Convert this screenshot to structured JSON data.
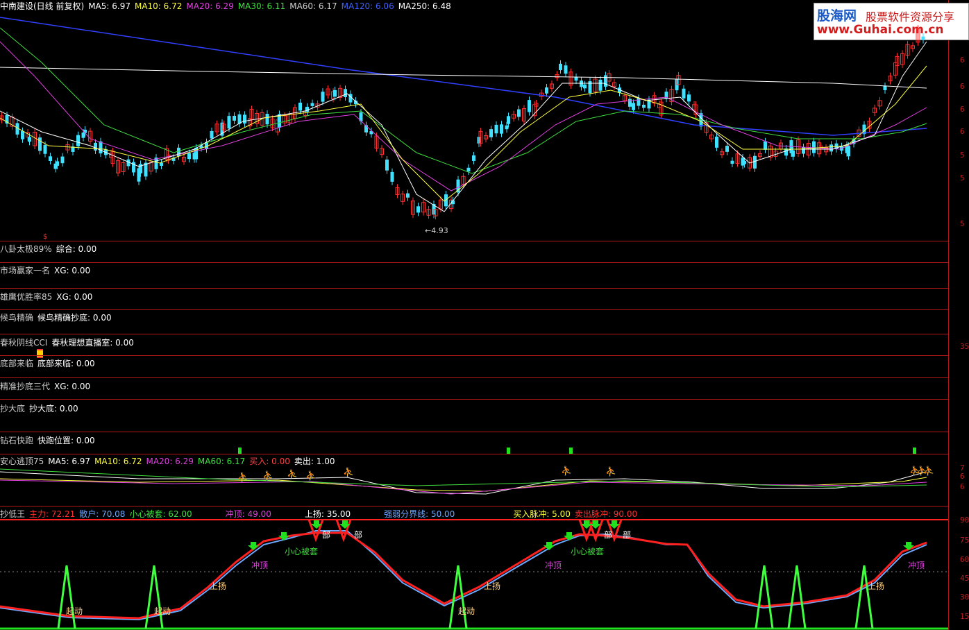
{
  "main": {
    "title": "中南建设(日线 前复权)",
    "ma_items": [
      {
        "label": "MA5: 6.97",
        "color": "#ffffff"
      },
      {
        "label": "MA10: 6.72",
        "color": "#ffff40"
      },
      {
        "label": "MA20: 6.29",
        "color": "#e040e0"
      },
      {
        "label": "MA30: 6.11",
        "color": "#40e040"
      },
      {
        "label": "MA60: 6.17",
        "color": "#d0d0d0"
      },
      {
        "label": "MA120: 6.06",
        "color": "#4060ff"
      },
      {
        "label": "MA250: 6.48",
        "color": "#ffffff"
      }
    ],
    "low_label": "4.93",
    "right_axis": [
      "6",
      "6",
      "6",
      "6",
      "5",
      "5",
      "5"
    ]
  },
  "logo": {
    "name": "股海网",
    "slogan": "股票软件资源分享",
    "url": "www.Guhai.com.cn"
  },
  "indicators": [
    {
      "name": "八卦太极89%",
      "value": "综合: 0.00",
      "value_color": "#ffffff"
    },
    {
      "name": "市场赢家一名",
      "value": "XG: 0.00",
      "value_color": "#ffffff"
    },
    {
      "name": "雄鹰优胜率85",
      "value": "XG: 0.00",
      "value_color": "#ffffff"
    },
    {
      "name": "候鸟精确",
      "value": "候鸟精确抄底: 0.00",
      "value_color": "#ffffff"
    },
    {
      "name": "春秋阴线CCI",
      "value": "春秋理想直播室: 0.00",
      "value_color": "#ffffff"
    },
    {
      "name": "底部来临",
      "value": "底部来临: 0.00",
      "value_color": "#ffffff"
    },
    {
      "name": "精准抄底三代",
      "value": "XG: 0.00",
      "value_color": "#ffffff"
    },
    {
      "name": "抄大底",
      "value": "抄大底: 0.00",
      "value_color": "#ffffff"
    },
    {
      "name": "钻石快跑",
      "value": "快跑位置: 0.00",
      "value_color": "#ffffff"
    }
  ],
  "escape": {
    "name": "安心逃顶75",
    "items": [
      {
        "label": "MA5: 6.97",
        "color": "#ffffff"
      },
      {
        "label": "MA10: 6.72",
        "color": "#ffff40"
      },
      {
        "label": "MA20: 6.29",
        "color": "#e040e0"
      },
      {
        "label": "MA60: 6.17",
        "color": "#40e040"
      },
      {
        "label": "买入: 0.00",
        "color": "#ff4040"
      },
      {
        "label": "卖出: 1.00",
        "color": "#ffffff"
      }
    ],
    "right_axis": [
      "7",
      "6",
      "6"
    ]
  },
  "bottom": {
    "name": "抄低王",
    "items": [
      {
        "label": "主力: 72.21",
        "color": "#ff3030"
      },
      {
        "label": "散户: 70.08",
        "color": "#6fa8ff"
      },
      {
        "label": "小心被套: 62.00",
        "color": "#40e040"
      },
      {
        "label": "冲顶: 49.00",
        "color": "#e040e0"
      },
      {
        "label": "上扬: 35.00",
        "color": "#ffffff"
      },
      {
        "label": "强弱分界线: 50.00",
        "color": "#6fa8ff"
      },
      {
        "label": "买入脉冲: 5.00",
        "color": "#ffff40"
      },
      {
        "label": "卖出脉冲: 90.00",
        "color": "#ff3030"
      }
    ],
    "annotations": {
      "bottom_word": "部",
      "trap": "小心被套",
      "peak": "冲顶",
      "rise": "上扬",
      "start": "起动"
    },
    "right_axis": [
      "90",
      "75",
      "60",
      "45",
      "30",
      "15"
    ]
  },
  "misc_axis_35": "35"
}
